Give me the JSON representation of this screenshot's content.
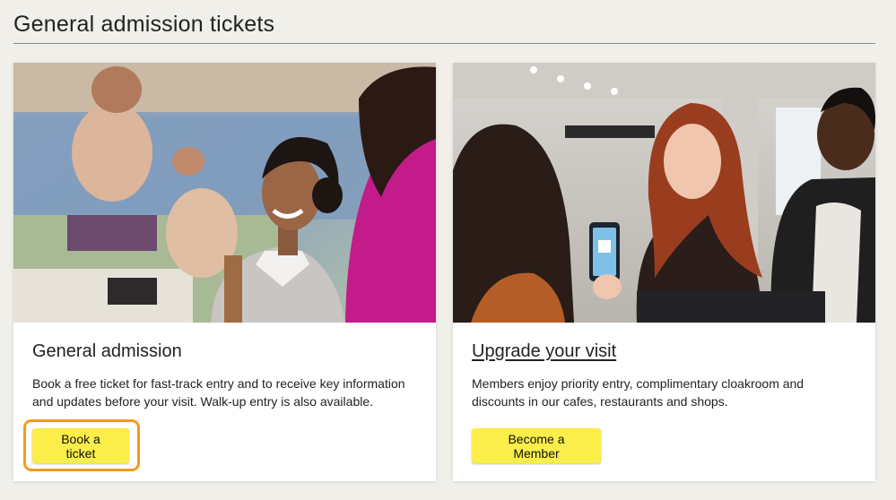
{
  "page": {
    "title": "General admission tickets"
  },
  "cards": [
    {
      "image_alt": "Smiling visitor in a gallery in front of a large painting of bathers",
      "title": "General admission",
      "body": "Book a free ticket for fast-track entry and to receive key information and updates before your visit. Walk-up entry is also available.",
      "button_label": "Book a ticket",
      "button_focused": true
    },
    {
      "image_alt": "Visitor showing a membership card on a phone at the museum entrance",
      "title": "Upgrade your visit",
      "body": "Members enjoy priority entry, complimentary cloakroom and discounts in our cafes, restaurants and shops.",
      "button_label": "Become a Member",
      "button_focused": false
    }
  ],
  "colors": {
    "background": "#f1efea",
    "button": "#fbed4a",
    "focus_ring": "#f39a1e",
    "card": "#ffffff"
  }
}
